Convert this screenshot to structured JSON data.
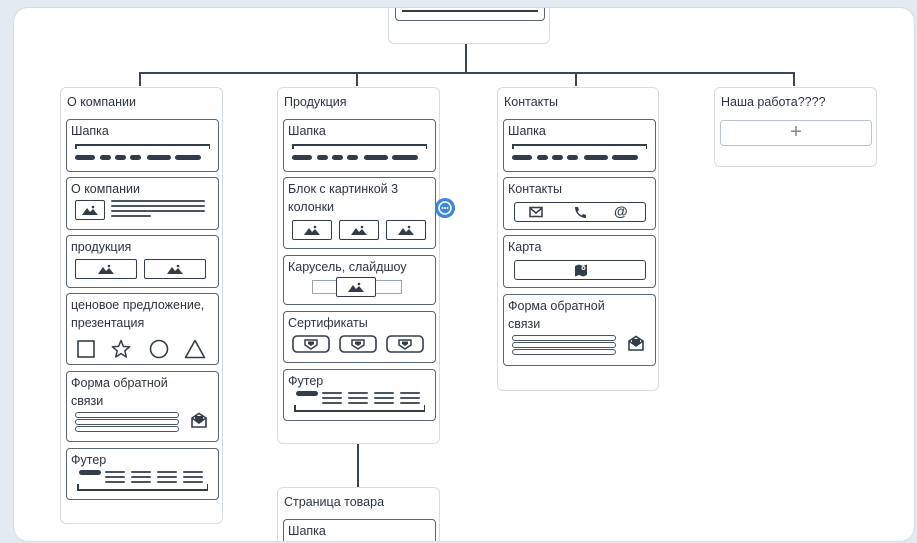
{
  "colors": {
    "line": "#3b4654",
    "accent_blue": "#3a86e0"
  },
  "columns": [
    {
      "title": "О компании",
      "blocks": [
        {
          "title": "Шапка",
          "kind": "header"
        },
        {
          "title": "О компании",
          "kind": "image-text"
        },
        {
          "title": "продукция",
          "kind": "two-images"
        },
        {
          "title": "ценовое предложение, презентация",
          "kind": "shapes",
          "icons": [
            "square-icon",
            "star-icon",
            "circle-icon",
            "triangle-icon"
          ]
        },
        {
          "title": "Форма обратной связи",
          "kind": "form",
          "icons": [
            "envelope-icon"
          ]
        },
        {
          "title": "Футер",
          "kind": "footer"
        }
      ]
    },
    {
      "title": "Продукция",
      "blocks": [
        {
          "title": "Шапка",
          "kind": "header"
        },
        {
          "title": "Блок с картинкой 3 колонки",
          "kind": "three-images"
        },
        {
          "title": "Карусель, слайдшоу",
          "kind": "carousel"
        },
        {
          "title": "Сертификаты",
          "kind": "certificates",
          "icons": [
            "certificate-icon",
            "certificate-icon",
            "certificate-icon"
          ]
        },
        {
          "title": "Футер",
          "kind": "footer"
        }
      ]
    },
    {
      "title": "Контакты",
      "blocks": [
        {
          "title": "Шапка",
          "kind": "header"
        },
        {
          "title": "Контакты",
          "kind": "contacts",
          "icons": [
            "mail-icon",
            "phone-icon",
            "at-sign-icon"
          ]
        },
        {
          "title": "Карта",
          "kind": "map",
          "icons": [
            "map-icon"
          ]
        },
        {
          "title": "Форма обратной связи",
          "kind": "form",
          "icons": [
            "envelope-icon"
          ]
        }
      ]
    },
    {
      "title": "Наша работа????",
      "blocks": [],
      "add_button": "+"
    }
  ],
  "subpage": {
    "title": "Страница товара",
    "blocks": [
      {
        "title": "Шапка",
        "kind": "header"
      }
    ]
  },
  "comment_icon": "comment-icon"
}
